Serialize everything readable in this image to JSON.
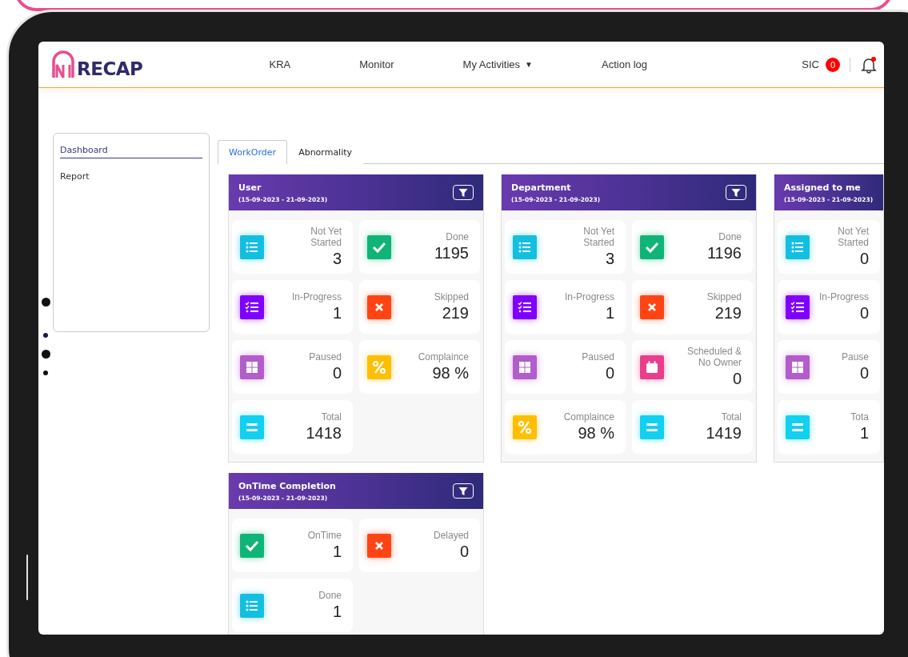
{
  "header": {
    "logo": "RECAP",
    "nav": [
      {
        "label": "KRA"
      },
      {
        "label": "Monitor"
      },
      {
        "label": "My Activities",
        "caret": "▼"
      },
      {
        "label": "Action log"
      }
    ],
    "user": "SIC",
    "badge": "0",
    "notification": true
  },
  "sidebar": {
    "items": [
      {
        "label": "Dashboard",
        "selected": true
      },
      {
        "label": "Report",
        "selected": false
      }
    ]
  },
  "tabs": [
    {
      "label": "WorkOrder",
      "selected": true
    },
    {
      "label": "Abnormality",
      "selected": false
    }
  ],
  "cards": [
    {
      "title": "User",
      "range": "(15-09-2023 - 21-09-2023)",
      "filter": true,
      "tiles": [
        {
          "kind": "list",
          "label": "Not Yet Started",
          "value": "3"
        },
        {
          "kind": "check",
          "label": "Done",
          "value": "1195"
        },
        {
          "kind": "tasks",
          "label": "In-Progress",
          "value": "1"
        },
        {
          "kind": "cross",
          "label": "Skipped",
          "value": "219"
        },
        {
          "kind": "grid",
          "label": "Paused",
          "value": "0"
        },
        {
          "kind": "percent",
          "label": "Complaince",
          "value": "98 %"
        },
        {
          "kind": "equals",
          "label": "Total",
          "value": "1418"
        }
      ]
    },
    {
      "title": "Department",
      "range": "(15-09-2023 - 21-09-2023)",
      "filter": true,
      "tiles": [
        {
          "kind": "list",
          "label": "Not Yet Started",
          "value": "3"
        },
        {
          "kind": "check",
          "label": "Done",
          "value": "1196"
        },
        {
          "kind": "tasks",
          "label": "In-Progress",
          "value": "1"
        },
        {
          "kind": "cross",
          "label": "Skipped",
          "value": "219"
        },
        {
          "kind": "grid",
          "label": "Paused",
          "value": "0"
        },
        {
          "kind": "calendar",
          "label": "Scheduled & No Owner",
          "value": "0"
        },
        {
          "kind": "percent",
          "label": "Complaince",
          "value": "98 %"
        },
        {
          "kind": "equals",
          "label": "Total",
          "value": "1419"
        }
      ]
    },
    {
      "title": "Assigned to me",
      "range": "(15-09-2023 - 21-09-2023)",
      "filter": false,
      "tiles": [
        {
          "kind": "list",
          "label": "Not Yet Started",
          "value": "0"
        },
        {
          "kind": "tasks",
          "label": "In-Progress",
          "value": "0"
        },
        {
          "kind": "grid",
          "label": "Pause",
          "value": "0"
        },
        {
          "kind": "equals",
          "label": "Tota",
          "value": "1"
        }
      ]
    },
    {
      "title": "OnTime Completion",
      "range": "(15-09-2023 - 21-09-2023)",
      "filter": true,
      "tiles": [
        {
          "kind": "check",
          "label": "OnTime",
          "value": "1"
        },
        {
          "kind": "cross",
          "label": "Delayed",
          "value": "0"
        },
        {
          "kind": "list",
          "label": "Done",
          "value": "1"
        }
      ]
    }
  ]
}
